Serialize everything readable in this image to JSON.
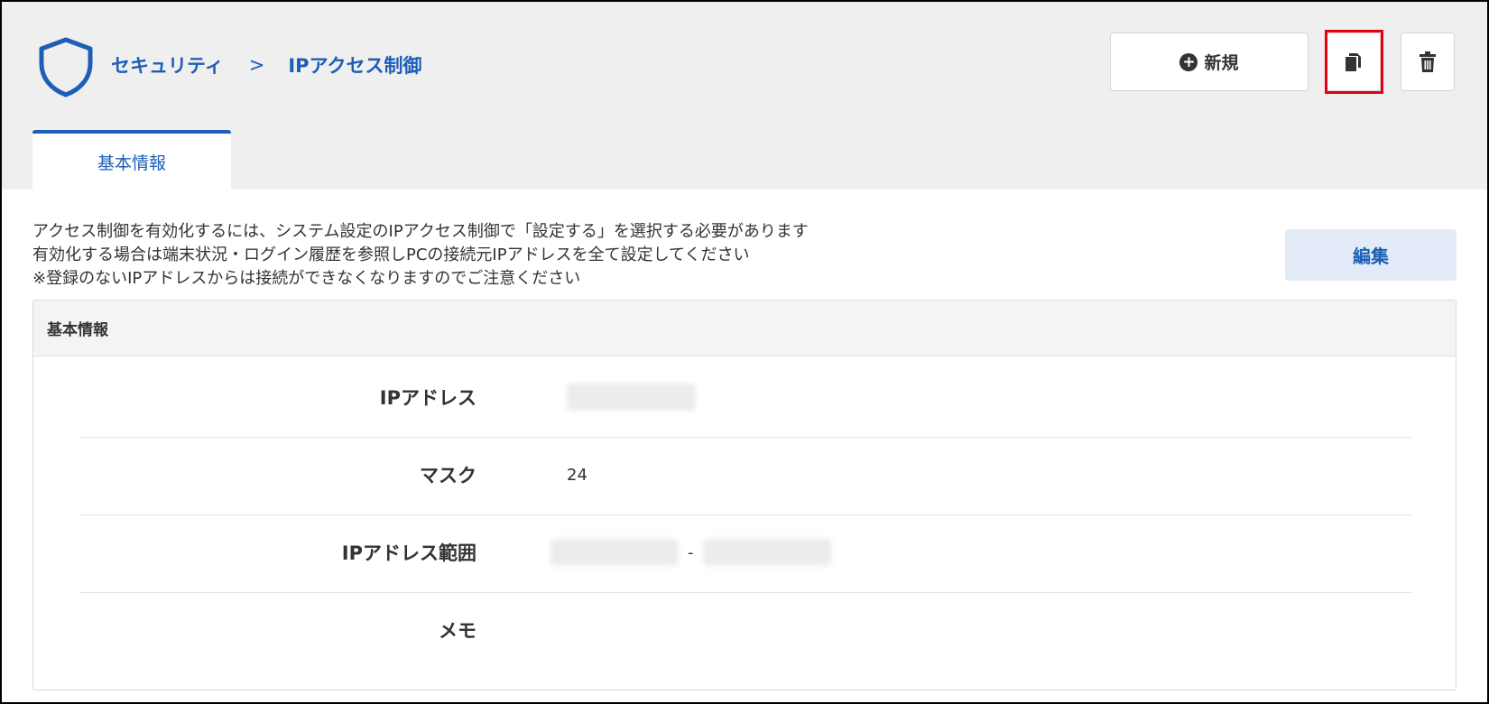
{
  "header": {
    "breadcrumb": {
      "section": "セキュリティ",
      "separator": ">",
      "page": "IPアクセス制御"
    },
    "actions": {
      "new_label": "新規",
      "copy_icon": "copy-icon",
      "trash_icon": "trash-icon"
    },
    "colors": {
      "accent": "#1d5fb7",
      "highlight": "#e60012"
    }
  },
  "tabs": [
    {
      "label": "基本情報",
      "active": true
    }
  ],
  "notice": {
    "lines": [
      "アクセス制御を有効化するには、システム設定のIPアクセス制御で「設定する」を選択する必要があります",
      "有効化する場合は端末状況・ログイン履歴を参照しPCの接続元IPアドレスを全て設定してください",
      "※登録のないIPアドレスからは接続ができなくなりますのでご注意ください"
    ]
  },
  "edit_label": "編集",
  "panel": {
    "title": "基本情報",
    "fields": [
      {
        "label": "IPアドレス",
        "value": ""
      },
      {
        "label": "マスク",
        "value": "24"
      },
      {
        "label": "IPアドレス範囲",
        "range_separator": "-"
      },
      {
        "label": "メモ",
        "value": ""
      }
    ]
  }
}
